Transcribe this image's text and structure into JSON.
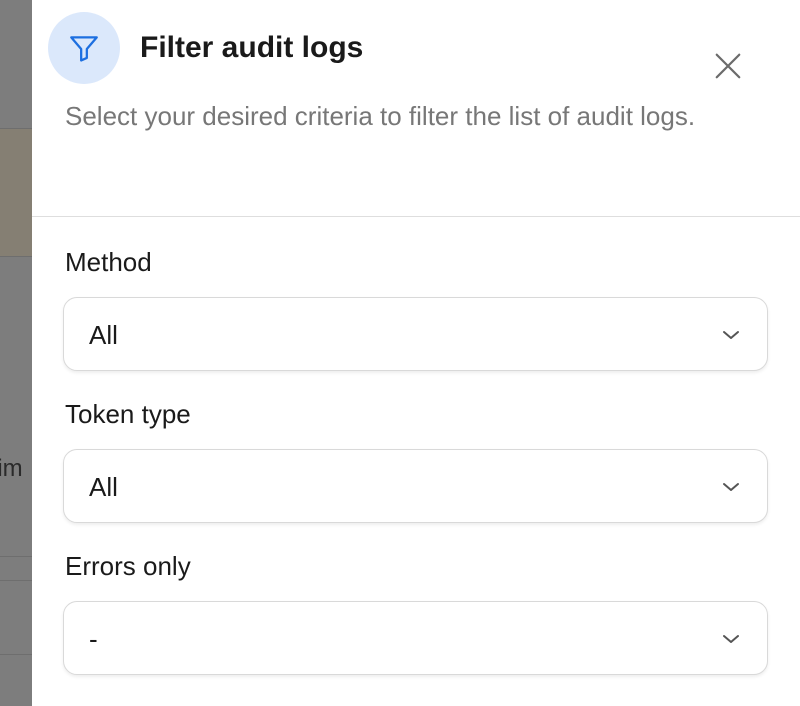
{
  "background": {
    "partial_text": "lim"
  },
  "dialog": {
    "title": "Filter audit logs",
    "description": "Select your desired criteria to filter the list of audit logs.",
    "header_icon": "filter-icon",
    "close_icon": "close-icon",
    "accent_color": "#1d6fe0",
    "icon_bg_color": "#dbe8fb"
  },
  "filters": {
    "method": {
      "label": "Method",
      "value": "All"
    },
    "token_type": {
      "label": "Token type",
      "value": "All"
    },
    "errors_only": {
      "label": "Errors only",
      "value": "-"
    }
  }
}
